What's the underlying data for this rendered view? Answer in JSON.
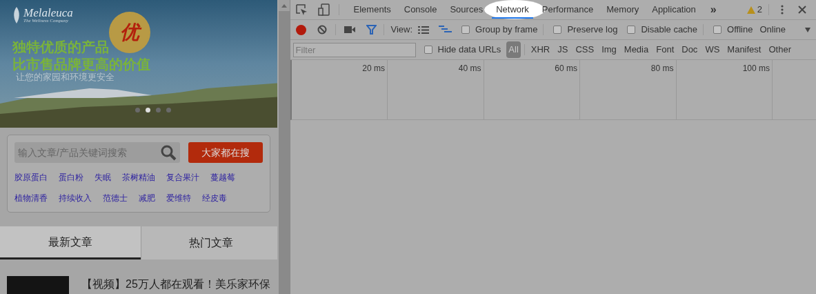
{
  "page": {
    "banner": {
      "logo": "Melaleuca",
      "logo_sub": "The Wellness Company",
      "badge": "优",
      "headline": [
        "独特优质的产品",
        "比市售品牌更高的价值"
      ],
      "subline": "让您的家园和环境更安全",
      "dots": [
        {
          "selected": false
        },
        {
          "selected": true
        },
        {
          "selected": false
        },
        {
          "selected": false
        }
      ]
    },
    "search": {
      "placeholder": "输入文章/产品关键词搜索",
      "button": "大家都在搜"
    },
    "keywords": [
      [
        "胶原蛋白",
        "蛋白粉",
        "失眠",
        "茶树精油",
        "复合果汁",
        "蔓越莓"
      ],
      [
        "植物清香",
        "持续收入",
        "范德士",
        "减肥",
        "爱维特",
        "经皮毒"
      ]
    ],
    "article_tabs": [
      {
        "label": "最新文章",
        "selected": true
      },
      {
        "label": "热门文章",
        "selected": false
      }
    ],
    "articles": [
      {
        "title": "【视频】25万人都在观看！美乐家环保"
      }
    ]
  },
  "devtools": {
    "tabs": [
      {
        "label": "Elements",
        "selected": false
      },
      {
        "label": "Console",
        "selected": false
      },
      {
        "label": "Sources",
        "selected": false
      },
      {
        "label": "Network",
        "selected": true
      },
      {
        "label": "Performance",
        "selected": false
      },
      {
        "label": "Memory",
        "selected": false
      },
      {
        "label": "Application",
        "selected": false
      }
    ],
    "more": "»",
    "warnings": "2",
    "toolbar": {
      "recording": true,
      "view_label": "View:",
      "options": [
        {
          "label": "Group by frame",
          "checked": false
        },
        {
          "label": "Preserve log",
          "checked": false
        },
        {
          "label": "Disable cache",
          "checked": false
        },
        {
          "label": "Offline",
          "checked": false
        }
      ],
      "throttle": "Online"
    },
    "filter": {
      "placeholder": "Filter",
      "hide_data_urls": {
        "label": "Hide data URLs",
        "checked": false
      },
      "types": [
        {
          "label": "All",
          "selected": true
        },
        {
          "label": "XHR",
          "selected": false
        },
        {
          "label": "JS",
          "selected": false
        },
        {
          "label": "CSS",
          "selected": false
        },
        {
          "label": "Img",
          "selected": false
        },
        {
          "label": "Media",
          "selected": false
        },
        {
          "label": "Font",
          "selected": false
        },
        {
          "label": "Doc",
          "selected": false
        },
        {
          "label": "WS",
          "selected": false
        },
        {
          "label": "Manifest",
          "selected": false
        },
        {
          "label": "Other",
          "selected": false
        }
      ]
    },
    "timeline_ticks": [
      "20 ms",
      "40 ms",
      "60 ms",
      "80 ms",
      "100 ms"
    ]
  }
}
